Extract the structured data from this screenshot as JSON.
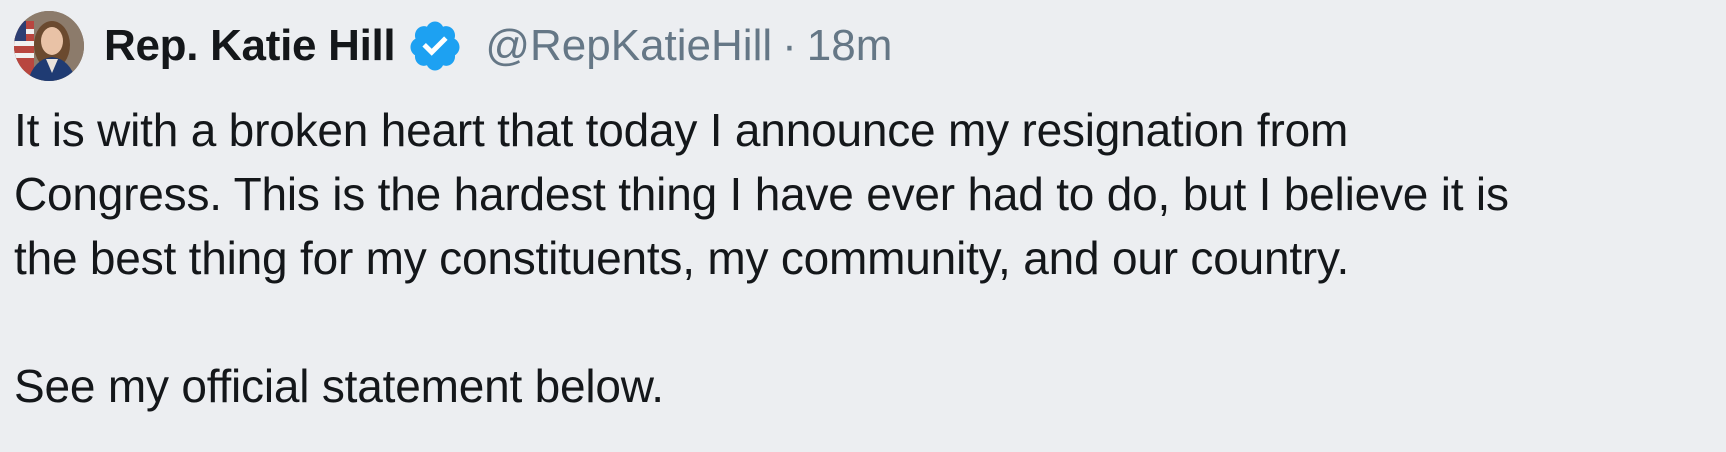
{
  "tweet": {
    "author_name": "Rep. Katie Hill",
    "handle": "@RepKatieHill",
    "separator": "·",
    "time": "18m",
    "verified_icon": "verified-badge-icon",
    "lines": [
      "It is with a broken heart that today I announce my resignation from",
      "Congress. This is the hardest thing I have ever had to do, but I believe it is",
      "the best thing for my constituents, my community, and our country."
    ],
    "closing_line": "See my official statement below."
  },
  "colors": {
    "background": "#eceef1",
    "text": "#14171a",
    "muted": "#657786",
    "verified_blue": "#1da1f2"
  }
}
